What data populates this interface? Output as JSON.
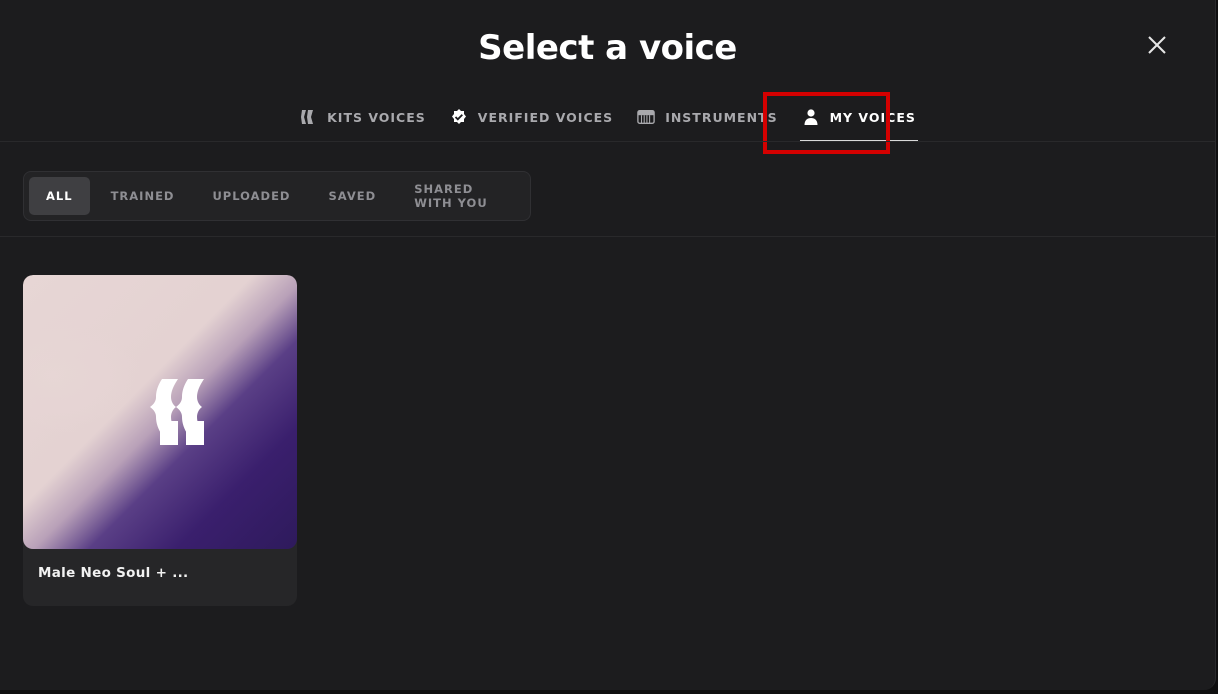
{
  "modal": {
    "title": "Select a voice"
  },
  "tabs": [
    {
      "label": "KITS VOICES",
      "icon": "kits-logo-icon",
      "active": false
    },
    {
      "label": "VERIFIED VOICES",
      "icon": "verified-badge-icon",
      "active": false
    },
    {
      "label": "INSTRUMENTS",
      "icon": "piano-icon",
      "active": false
    },
    {
      "label": "MY VOICES",
      "icon": "user-icon",
      "active": true
    }
  ],
  "filters": [
    {
      "label": "ALL",
      "active": true
    },
    {
      "label": "TRAINED",
      "active": false
    },
    {
      "label": "UPLOADED",
      "active": false
    },
    {
      "label": "SAVED",
      "active": false
    },
    {
      "label": "SHARED WITH YOU",
      "active": false
    }
  ],
  "voices": [
    {
      "name": "Male Neo Soul + ...",
      "icon": "kits-logo-icon"
    }
  ],
  "colors": {
    "background": "#1c1c1e",
    "highlight": "#d40000",
    "active_chip": "#3f3f42"
  }
}
